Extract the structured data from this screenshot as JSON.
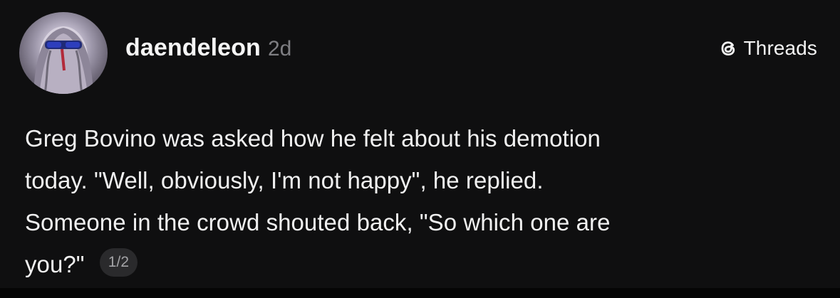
{
  "post": {
    "username": "daendeleon",
    "timestamp": "2d",
    "brand_label": "Threads",
    "brand_icon": "threads-logo-icon",
    "avatar_icon": "user-avatar-photo",
    "body_lines": [
      "Greg Bovino was asked how he felt about his demotion",
      "today. \"Well, obviously, I'm not happy\", he replied.",
      "Someone in the crowd shouted back, \"So which one are",
      "you?\""
    ],
    "page_indicator": "1/2"
  },
  "colors": {
    "background": "#0f0f10",
    "text": "#f3f3f3",
    "muted": "#7e7e82",
    "pill": "#2a2a2c"
  }
}
